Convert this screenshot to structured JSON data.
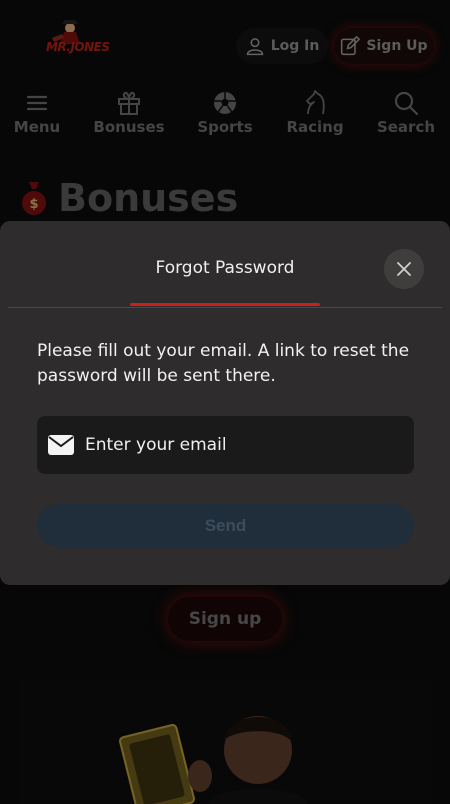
{
  "header": {
    "logo_text": "MR.JONES",
    "login_label": "Log In",
    "signup_label": "Sign Up"
  },
  "nav": {
    "items": [
      {
        "label": "Menu",
        "icon": "hamburger-icon"
      },
      {
        "label": "Bonuses",
        "icon": "gift-icon"
      },
      {
        "label": "Sports",
        "icon": "soccer-ball-icon"
      },
      {
        "label": "Racing",
        "icon": "horse-icon"
      },
      {
        "label": "Search",
        "icon": "search-icon"
      }
    ]
  },
  "page": {
    "title": "Bonuses",
    "title_icon": "money-bag-icon",
    "signup_label": "Sign up"
  },
  "modal": {
    "title": "Forgot Password",
    "description": "Please fill out your email. A link to reset the password will be sent there.",
    "email_placeholder": "Enter your email",
    "send_label": "Send",
    "close_icon": "close-icon"
  },
  "colors": {
    "accent_red": "#c8201a",
    "modal_bg": "#2e2c2c",
    "send_disabled": "#1f2e3a"
  }
}
